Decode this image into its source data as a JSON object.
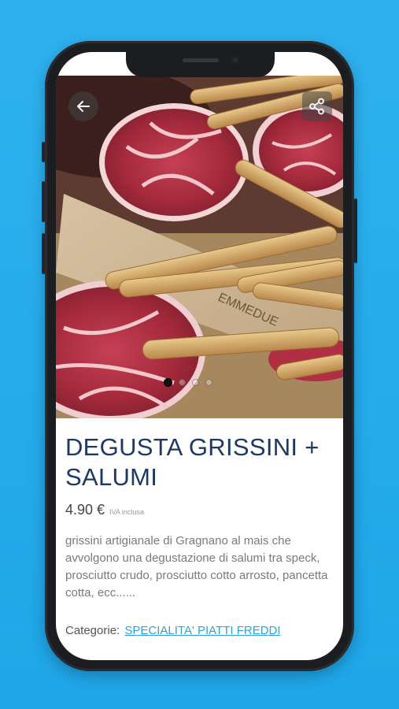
{
  "product": {
    "title": "DEGUSTA GRISSINI + SALUMI",
    "price": "4.90 €",
    "vat_note": "IVA inclusa",
    "description": "grissini artigianale di Gragnano al mais che avvolgono una degustazione di salumi tra speck, prosciutto crudo, prosciutto cotto arrosto, pancetta cotta, ecc......",
    "categories_label": "Categorie:",
    "category_link": "SPECIALITA' PIATTI FREDDI",
    "board_text": "EMMEDUE"
  },
  "gallery": {
    "image_count": 4,
    "active_index": 0
  },
  "icons": {
    "back": "arrow-left-icon",
    "share": "share-icon"
  },
  "colors": {
    "background": "#1ea6e8",
    "title": "#1d3b62",
    "link": "#2ea3d9"
  }
}
